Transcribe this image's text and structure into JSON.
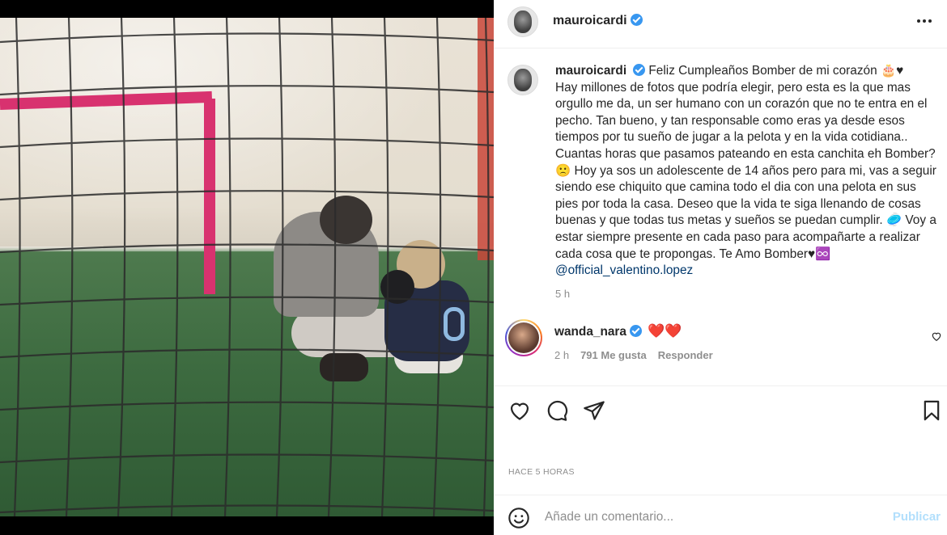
{
  "post": {
    "username": "mauroicardi",
    "caption_parts": [
      "Feliz Cumpleaños Bomber de mi corazón 🎂♥",
      "Hay millones de fotos que podría elegir, pero esta es la que mas orgullo me da, un ser humano con un corazón que no te entra en el pecho. Tan bueno, y tan responsable como eras ya desde esos tiempos por tu sueño de jugar a la pelota y en la vida cotidiana.. Cuantas horas que pasamos pateando en esta canchita eh Bomber? 🙁 Hoy ya sos un adolescente de 14 años pero para mi, vas a seguir siendo ese chiquito que camina todo el dia con una pelota en sus pies por toda la casa. Deseo que la vida te siga llenando de cosas buenas y que todas tus metas y sueños se puedan cumplir. 🥏 Voy a estar siempre presente en cada paso para acompañarte a realizar cada cosa que te propongas. Te Amo Bomber♥♾️ "
    ],
    "mention": "@official_valentino.lopez",
    "caption_time": "5 h",
    "time_label": "HACE 5 HORAS"
  },
  "comment": {
    "username": "wanda_nara",
    "text": "❤️❤️",
    "time": "2 h",
    "likes": "791 Me gusta",
    "reply": "Responder"
  },
  "add_comment": {
    "placeholder": "Añade un comentario...",
    "publish": "Publicar"
  },
  "icons": {
    "like": "heart-icon",
    "comment": "comment-icon",
    "share": "paper-plane-icon",
    "save": "bookmark-icon",
    "emoji": "smiley-icon",
    "more": "more-horizontal-icon"
  },
  "colors": {
    "verified": "#3897f0",
    "link": "#00376b",
    "publish_disabled": "#b2dffc",
    "muted": "#8e8e8e"
  }
}
